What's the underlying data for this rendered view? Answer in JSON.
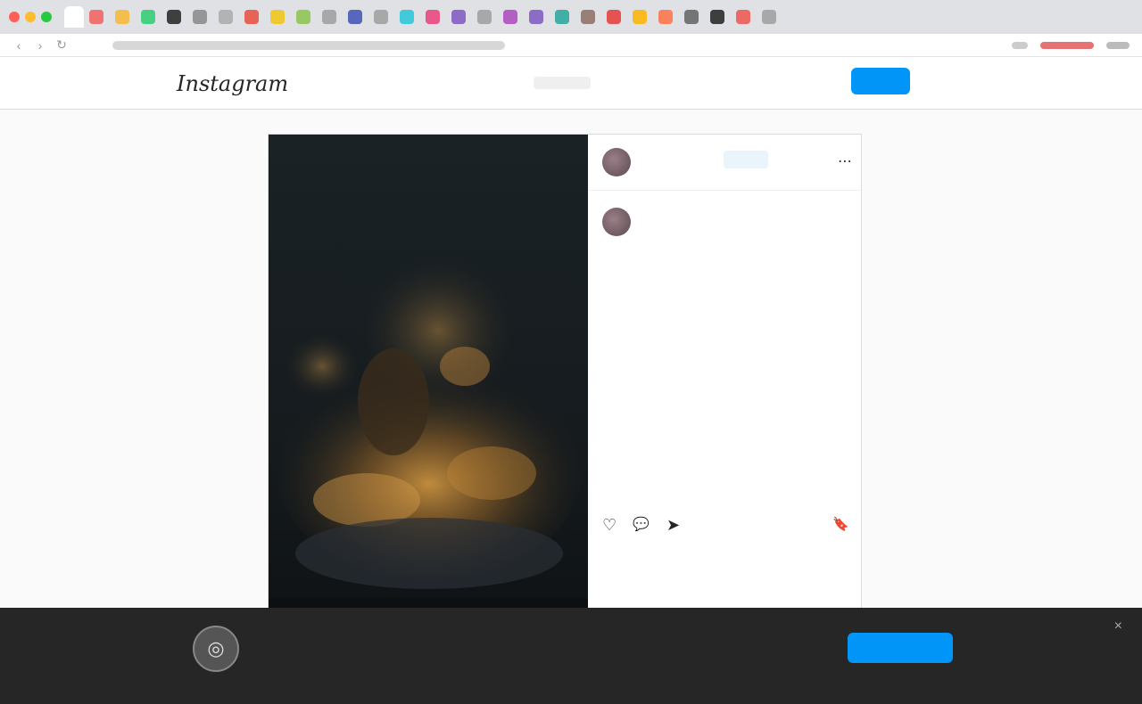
{
  "browser": {
    "tab_colors": [
      "#f25f5c",
      "#f7b731",
      "#2ecc71",
      "#222222",
      "#888888",
      "#aaaaaa",
      "#e74c3c",
      "#f1c40f",
      "#8bc34a",
      "#9e9e9e",
      "#3f51b5",
      "#9e9e9e",
      "#26c6da",
      "#ec407a",
      "#7e57c2",
      "#9e9e9e",
      "#ab47bc",
      "#7e57c2",
      "#26a69a",
      "#8d6e63",
      "#e53935",
      "#ffb300",
      "#ff7043",
      "#616161",
      "#212121",
      "#ef5350",
      "#9e9e9e"
    ]
  },
  "header": {
    "logo_text": "Instagram",
    "search_placeholder": "",
    "login_label": "",
    "signup_label": ""
  },
  "post": {
    "username": "",
    "follow_label": "",
    "caption_username": "",
    "caption_text": "",
    "likes": "",
    "date": "",
    "media_caption": ""
  },
  "banner": {
    "title": "",
    "text": "",
    "login_label": "",
    "signup_label": "",
    "close_icon": "×"
  },
  "icons": {
    "heart": "♡",
    "comment": "💬",
    "share": "➤",
    "bookmark": "🔖",
    "more": "⋯"
  }
}
